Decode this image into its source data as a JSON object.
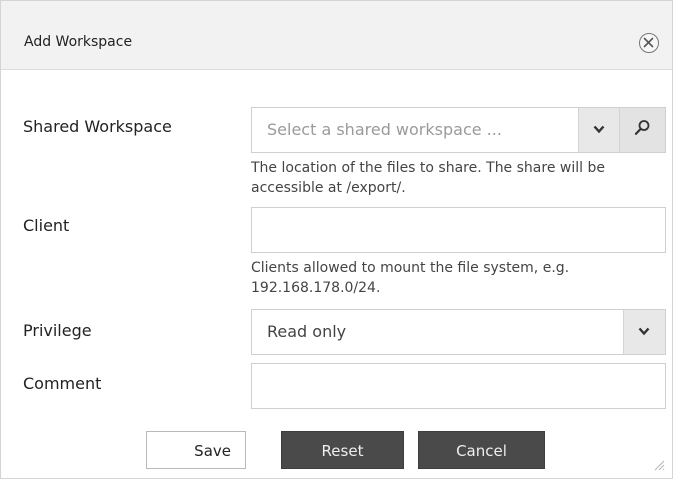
{
  "dialog": {
    "title": "Add Workspace",
    "close_icon": "close-circle-icon"
  },
  "form": {
    "shared_workspace": {
      "label": "Shared Workspace",
      "placeholder": "Select a shared workspace ...",
      "help": "The location of the files to share. The share will be accessible at /export/.",
      "dropdown_icon": "chevron-down-icon",
      "search_icon": "search-icon"
    },
    "client": {
      "label": "Client",
      "value": "",
      "help": "Clients allowed to mount the file system, e.g. 192.168.178.0/24."
    },
    "privilege": {
      "label": "Privilege",
      "value": "Read only",
      "dropdown_icon": "chevron-down-icon"
    },
    "comment": {
      "label": "Comment",
      "value": ""
    }
  },
  "buttons": {
    "save": "Save",
    "reset": "Reset",
    "cancel": "Cancel"
  },
  "colors": {
    "header_bg": "#f2f2f2",
    "dark_button": "#4a4a4a",
    "field_border": "#cfcfcf"
  }
}
